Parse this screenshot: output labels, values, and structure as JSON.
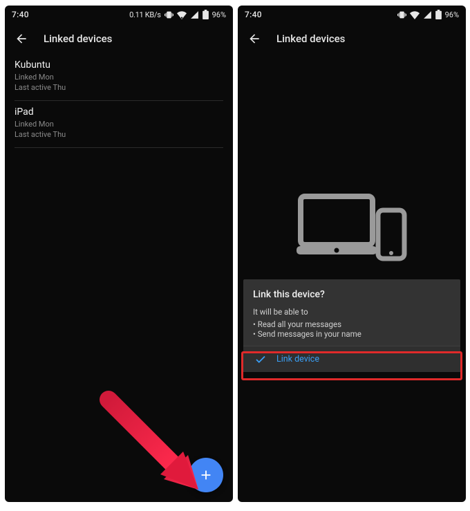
{
  "statusbar": {
    "time": "7:40",
    "rate": "0.11 KB/s",
    "battery_pct": "96%"
  },
  "appbar": {
    "title": "Linked devices"
  },
  "devices": [
    {
      "name": "Kubuntu",
      "linked": "Linked Mon",
      "active": "Last active Thu"
    },
    {
      "name": "iPad",
      "linked": "Linked Mon",
      "active": "Last active Thu"
    }
  ],
  "link_card": {
    "title": "Link this device?",
    "subtitle": "It will be able to",
    "bullet1": "• Read all your messages",
    "bullet2": "• Send messages in your name",
    "action": "Link device"
  },
  "colors": {
    "accent": "#4285f4",
    "link_blue": "#3a9ff5",
    "highlight_red": "#e02a2a",
    "card_bg": "#333333"
  }
}
